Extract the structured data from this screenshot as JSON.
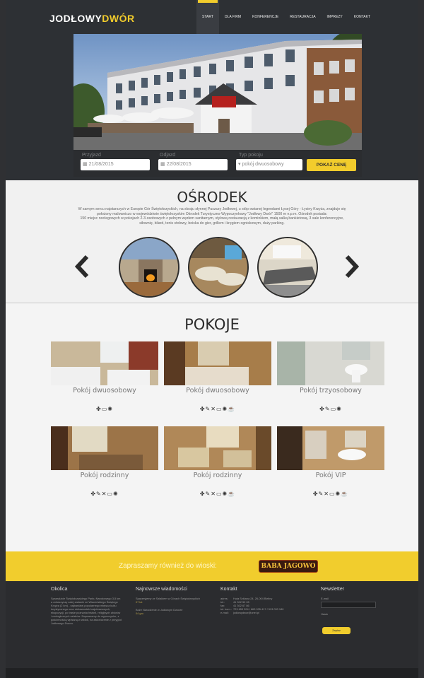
{
  "brand": {
    "part1": "JODŁOWY",
    "part2": "DWÓR"
  },
  "nav": [
    "START",
    "DLA FIRM",
    "KONFERENCJE",
    "RESTAURACJA",
    "IMPREZY",
    "KONTAKT"
  ],
  "booking": {
    "arrival_label": "Przyjazd",
    "arrival_value": "21/08/2015",
    "departure_label": "Odjazd",
    "departure_value": "22/08/2015",
    "room_type_label": "Typ pokoju",
    "room_type_value": "pokój dwuosobowy",
    "button": "POKAŻ CENĘ"
  },
  "osrodek": {
    "title": "OŚRODEK",
    "text1": "W samym sercu najstarszych w Europie Gór Świętokrzyskich, na skraju słynnej Puszczy Jodłowej, u stóp owianej legendami Łysej Góry - Łysiny Krzyża, znajduje się",
    "text2": "położony malowniczo w województwie świętokrzyskim Ośrodek Turystyczno-Wypoczynkowy \"Jodłowy Dwór\" 1500 m n.p.m. Ośrodek posiada:",
    "text3": "150 miejsc noclegowych w pokojach 2-3-osobowych z pełnym węzłem sanitarnym, stylową restauracją z kominkiem, małą salką bankietową, 3 sale konferencyjne,",
    "text4": "siłownię, bilard, tenis stołowy, boiska do gier, grillem i kręgiem ogniskowym, duży parking."
  },
  "pokoje": {
    "title": "POKOJE",
    "rooms": [
      {
        "name": "Pokój dwuosobowy",
        "icons": "✤▭✺"
      },
      {
        "name": "Pokój dwuosobowy",
        "icons": "✤✎✕▭✺☕"
      },
      {
        "name": "Pokój trzyosobowy",
        "icons": "✤✎▭✺"
      },
      {
        "name": "Pokój rodzinny",
        "icons": "✤✎✕▭✺"
      },
      {
        "name": "Pokój rodzinny",
        "icons": "✤✎✕▭✺☕"
      },
      {
        "name": "Pokój VIP",
        "icons": "✤✎✕▭✺☕"
      }
    ]
  },
  "band": {
    "text": "Zapraszamy również do wioski:",
    "logo": "BABA JAGOWO"
  },
  "footer": {
    "okolica": {
      "title": "Okolica",
      "text": "Sprawdźcie Świętokrzyskiego Parku Narodowego 3,5 km a zobaczyszy całej zadanie ze Wiaceńskiego Świętego Krzyża (2 km) - najbardziej popularnego miejsca kultu turystycznego oraz ciekawostek krajobrazowych, ekspozycji, po trasie poznania historii, religijnych zbiorów i zoologicznych szlaków. Zapraszamy do wypoczynku, z gościnnością wpisaną w widok, na zakończenie z przygód Jodłowego Dworu."
    },
    "news": {
      "title": "Najnowsze wiadomości",
      "items": [
        {
          "text": "Spaceryjemy ze Szlakiem w Górach Świętokrzyskich",
          "date": "07 lut"
        },
        {
          "text": "Boże Narodzenie w Jodłowym Dworze",
          "date": "04 gru"
        }
      ]
    },
    "contact": {
      "title": "Kontakt",
      "rows": [
        {
          "k": "adres:",
          "v": "Huta Szklana 24, 26-004 Bieliny"
        },
        {
          "k": "tel.:",
          "v": "41 302 50 28"
        },
        {
          "k": "fax:",
          "v": "41 302 67 86"
        },
        {
          "k": "tel. kom.:",
          "v": "723 653 324 / 663 035 417 / 513 033 180"
        },
        {
          "k": "e-mail:",
          "v": "jodlowydwor@onet.pl"
        }
      ]
    },
    "newsletter": {
      "title": "Newsletter",
      "email_label": "E-mail",
      "password_label": "Hasło",
      "button": "Zapisz"
    }
  }
}
